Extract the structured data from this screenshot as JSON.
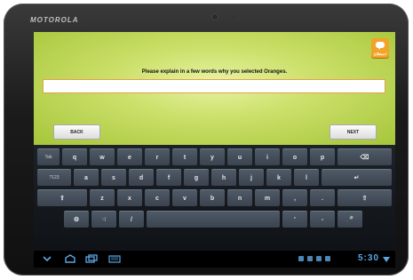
{
  "device": {
    "brand": "MOTOROLA"
  },
  "app": {
    "logo_text": "استطلاع",
    "question": "Please explain in a few words why you selected Oranges.",
    "answer_value": "",
    "back_label": "BACK",
    "next_label": "NEXT"
  },
  "keyboard": {
    "row1": [
      "Tab",
      "q",
      "w",
      "e",
      "r",
      "t",
      "y",
      "u",
      "i",
      "o",
      "p",
      "⌫"
    ],
    "row2": [
      "?123",
      "a",
      "s",
      "d",
      "f",
      "g",
      "h",
      "j",
      "k",
      "l",
      "↵"
    ],
    "row3": [
      "⇧",
      "z",
      "x",
      "c",
      "v",
      "b",
      "n",
      "m",
      ",",
      ".",
      "⇧"
    ],
    "row4": [
      "⚙",
      ":-)",
      "/",
      " ",
      "'",
      "-",
      "🎤"
    ]
  },
  "system_bar": {
    "time": "5:30",
    "nav_icons": [
      "back-icon",
      "home-icon",
      "recent-apps-icon",
      "menu-icon"
    ]
  },
  "colors": {
    "accent": "#5aa7e6",
    "app_bg": "#cbe06a",
    "input_border": "#e5a04a",
    "logo": "#f2a328"
  }
}
